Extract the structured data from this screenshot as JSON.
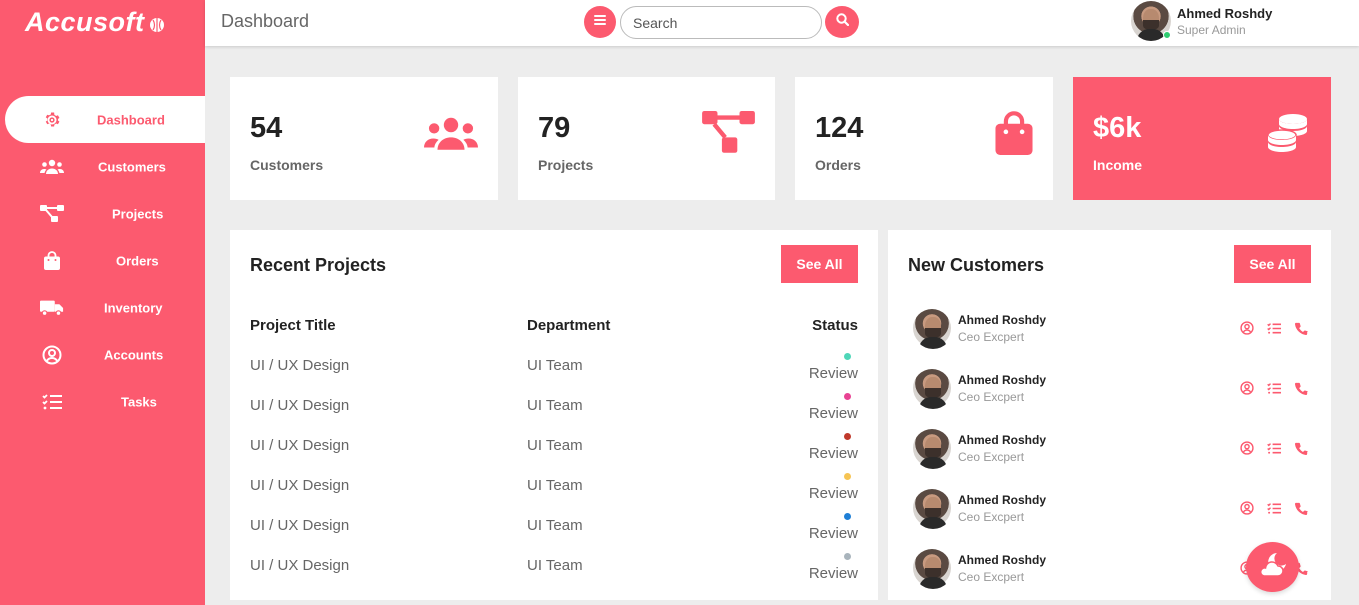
{
  "brand": {
    "name": "Accusoft"
  },
  "sidebar": {
    "items": [
      {
        "label": "Dashboard",
        "icon": "gear-icon",
        "active": true
      },
      {
        "label": "Customers",
        "icon": "users-icon"
      },
      {
        "label": "Projects",
        "icon": "diagram-icon"
      },
      {
        "label": "Orders",
        "icon": "shopping-bag-icon"
      },
      {
        "label": "Inventory",
        "icon": "truck-icon"
      },
      {
        "label": "Accounts",
        "icon": "user-circle-icon"
      },
      {
        "label": "Tasks",
        "icon": "tasks-icon"
      }
    ]
  },
  "header": {
    "title": "Dashboard",
    "search_placeholder": "Search",
    "user": {
      "name": "Ahmed Roshdy",
      "role": "Super Admin",
      "status": "online"
    }
  },
  "stats": [
    {
      "value": "54",
      "label": "Customers",
      "icon": "users-icon"
    },
    {
      "value": "79",
      "label": "Projects",
      "icon": "diagram-icon"
    },
    {
      "value": "124",
      "label": "Orders",
      "icon": "shopping-bag-icon"
    },
    {
      "value": "$6k",
      "label": "Income",
      "icon": "coins-icon",
      "highlight": true
    }
  ],
  "recent_projects": {
    "title": "Recent Projects",
    "see_all": "See All",
    "columns": [
      "Project Title",
      "Department",
      "Status"
    ],
    "rows": [
      {
        "title": "UI / UX Design",
        "department": "UI Team",
        "status": "Review",
        "dot_color": "#4fd6b8"
      },
      {
        "title": "UI / UX Design",
        "department": "UI Team",
        "status": "Review",
        "dot_color": "#e84393"
      },
      {
        "title": "UI / UX Design",
        "department": "UI Team",
        "status": "Review",
        "dot_color": "#c0392b"
      },
      {
        "title": "UI / UX Design",
        "department": "UI Team",
        "status": "Review",
        "dot_color": "#f6c453"
      },
      {
        "title": "UI / UX Design",
        "department": "UI Team",
        "status": "Review",
        "dot_color": "#1e7fd6"
      },
      {
        "title": "UI / UX Design",
        "department": "UI Team",
        "status": "Review",
        "dot_color": "#a9b4bc"
      }
    ]
  },
  "new_customers": {
    "title": "New Customers",
    "see_all": "See All",
    "items": [
      {
        "name": "Ahmed Roshdy",
        "role": "Ceo Excpert"
      },
      {
        "name": "Ahmed Roshdy",
        "role": "Ceo Excpert"
      },
      {
        "name": "Ahmed Roshdy",
        "role": "Ceo Excpert"
      },
      {
        "name": "Ahmed Roshdy",
        "role": "Ceo Excpert"
      },
      {
        "name": "Ahmed Roshdy",
        "role": "Ceo Excpert"
      }
    ]
  },
  "colors": {
    "accent": "#fc5a6f",
    "background": "#ededed",
    "card": "#ffffff"
  }
}
